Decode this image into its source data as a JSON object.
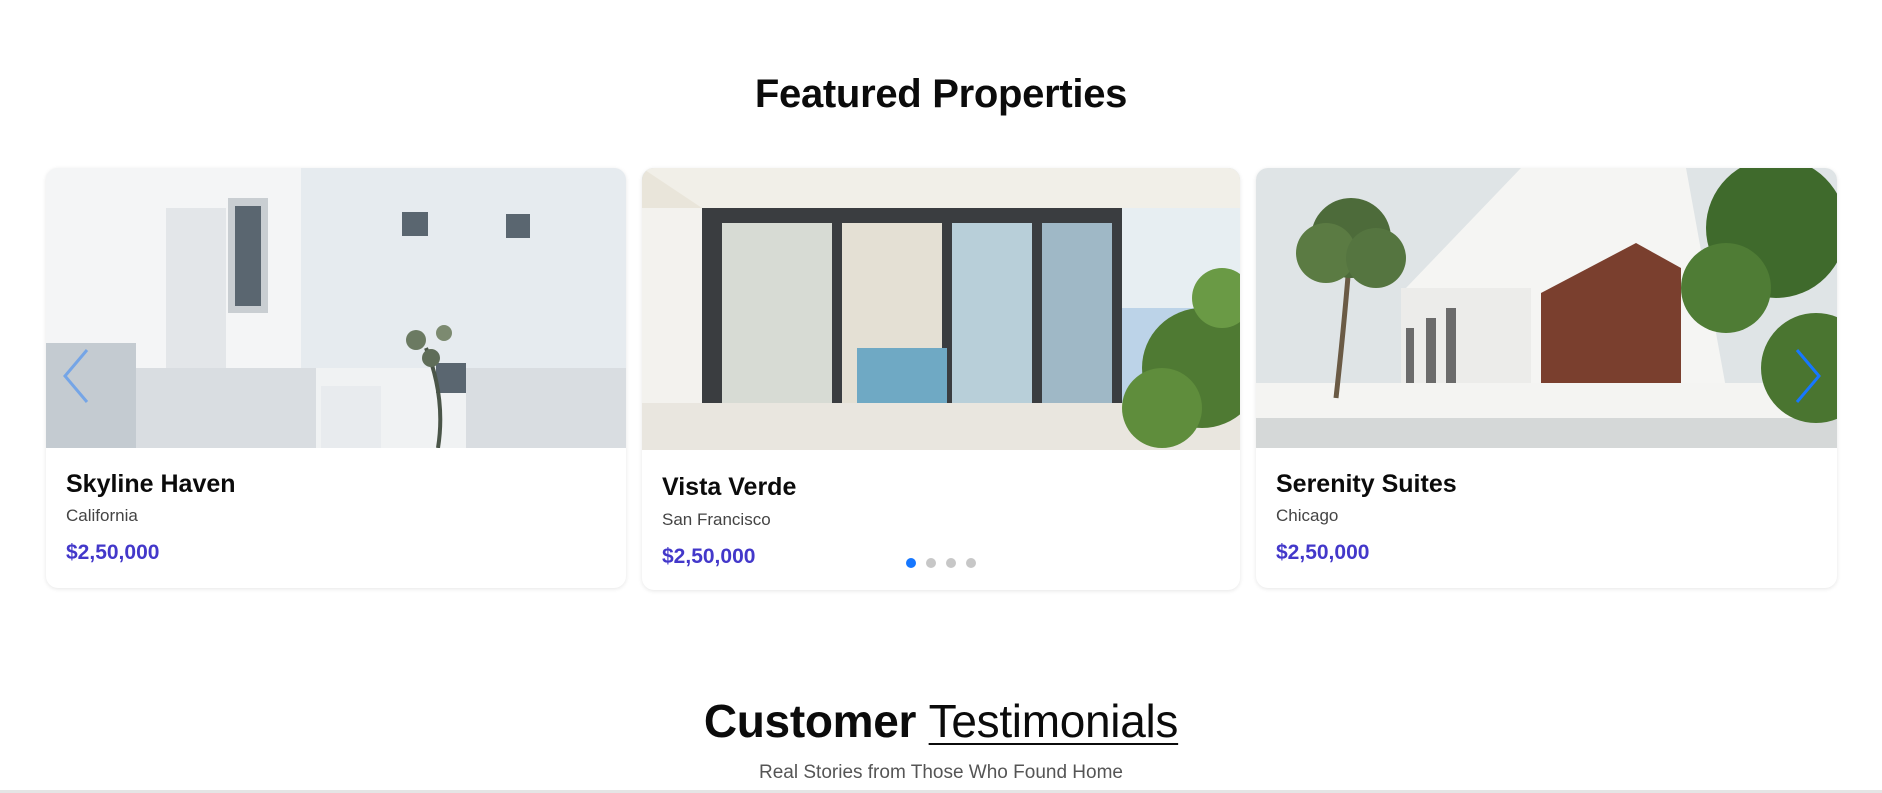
{
  "featured": {
    "title": "Featured Properties",
    "properties": [
      {
        "name": "Skyline Haven",
        "location": "California",
        "price": "$2,50,000",
        "image": "white-modern-house-photo"
      },
      {
        "name": "Vista Verde",
        "location": "San Francisco",
        "price": "$2,50,000",
        "image": "glass-patio-house-photo"
      },
      {
        "name": "Serenity Suites",
        "location": "Chicago",
        "price": "$2,50,000",
        "image": "palm-tree-villa-photo"
      }
    ],
    "pagination": {
      "total": 4,
      "active": 1
    },
    "prev_icon": "chevron-left-icon",
    "next_icon": "chevron-right-icon"
  },
  "testimonials": {
    "title_bold": "Customer",
    "title_light": "Testimonials",
    "subtitle": "Real Stories from Those Who Found Home"
  },
  "colors": {
    "price": "#4338ca",
    "accent": "#1677ff",
    "dot_inactive": "#c7c7c7"
  }
}
